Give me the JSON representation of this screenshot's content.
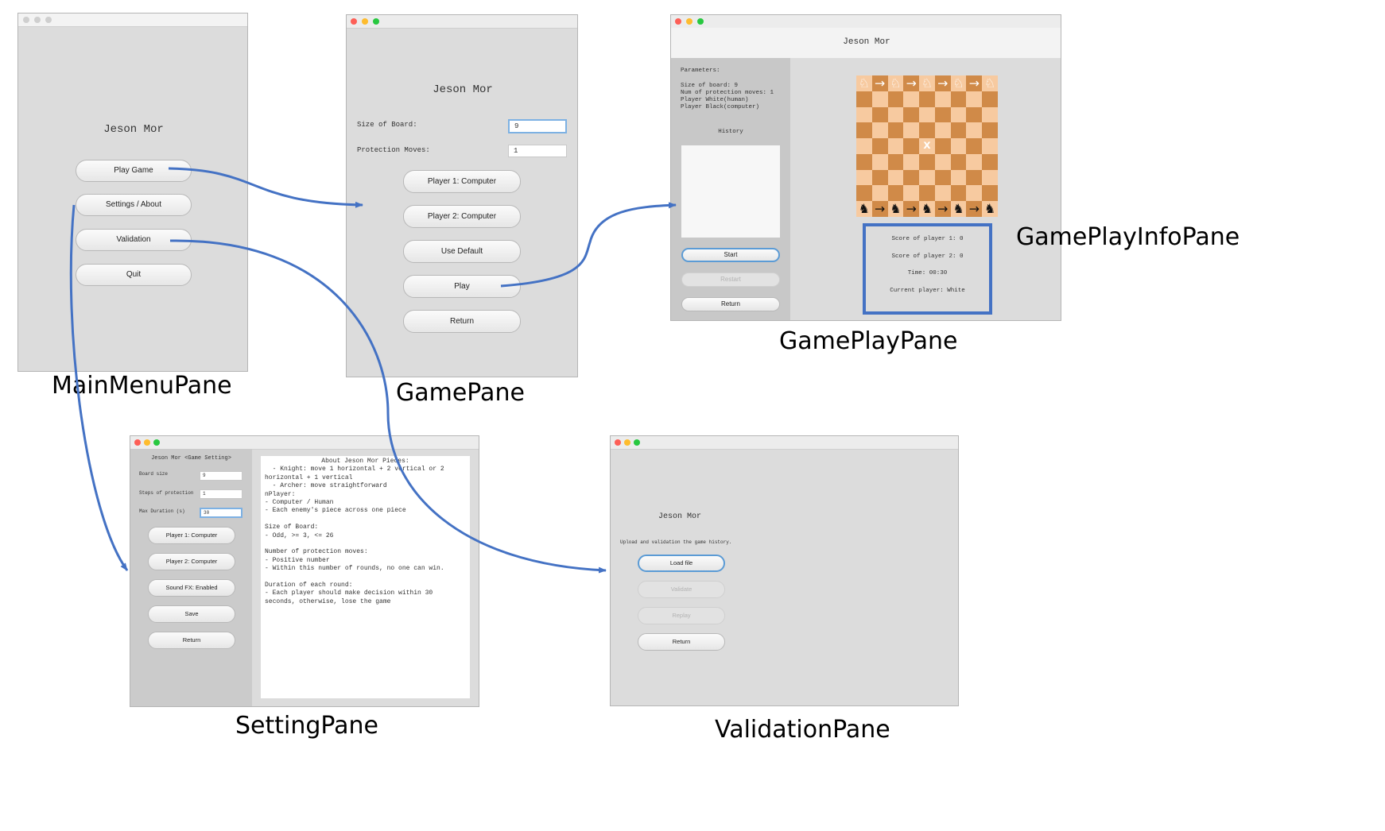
{
  "main_menu": {
    "title": "Jeson Mor",
    "buttons": [
      "Play Game",
      "Settings / About",
      "Validation",
      "Quit"
    ],
    "caption": "MainMenuPane"
  },
  "game_pane": {
    "title": "Jeson Mor",
    "size_label": "Size of Board:",
    "size_value": "9",
    "protection_label": "Protection Moves:",
    "protection_value": "1",
    "buttons": [
      "Player 1: Computer",
      "Player 2: Computer",
      "Use Default",
      "Play",
      "Return"
    ],
    "caption": "GamePane"
  },
  "gameplay_pane": {
    "title": "Jeson Mor",
    "params_header": "Parameters:",
    "params": [
      "Size of board: 9",
      "Num of protection moves: 1",
      "Player White(human)",
      "Player Black(computer)"
    ],
    "history_label": "History",
    "buttons": [
      "Start",
      "Restart",
      "Return"
    ],
    "info": [
      "Score of player 1: 0",
      "Score of player 2: 0",
      "Time: 00:30",
      "Current player: White"
    ],
    "center_mark": "X",
    "caption": "GamePlayPane",
    "info_caption": "GamePlayInfoPane"
  },
  "setting_pane": {
    "title": "Jeson Mor <Game Setting>",
    "fields": [
      {
        "label": "Board size",
        "value": "9"
      },
      {
        "label": "Steps of protection",
        "value": "1"
      },
      {
        "label": "Max Duration (s)",
        "value": "30"
      }
    ],
    "buttons": [
      "Player 1: Computer",
      "Player 2: Computer",
      "Sound FX: Enabled",
      "Save",
      "Return"
    ],
    "about_title": "About Jeson Mor Pieces:",
    "about_lines": [
      "  - Knight: move 1 horizontal + 2 vertical or 2",
      "horizontal + 1 vertical",
      "  - Archer: move straightforward",
      "nPlayer:",
      "- Computer / Human",
      "- Each enemy's piece across one piece",
      "",
      "Size of Board:",
      "- Odd, >= 3, <= 26",
      "",
      "Number of protection moves:",
      "- Positive number",
      "- Within this number of rounds, no one can win.",
      "",
      "Duration of each round:",
      "- Each player should make decision within 30",
      "seconds, otherwise, lose the game"
    ],
    "caption": "SettingPane"
  },
  "validation_pane": {
    "title": "Jeson Mor",
    "instruction": "Upload and validation the game history.",
    "buttons": [
      "Load file",
      "Validate",
      "Replay",
      "Return"
    ],
    "caption": "ValidationPane"
  },
  "colors": {
    "arrow": "#4472c4",
    "board_light": "#f7caa0",
    "board_dark": "#d08a48",
    "traffic_red": "#fd5f57",
    "traffic_yellow": "#febc2e",
    "traffic_green": "#28c840"
  }
}
